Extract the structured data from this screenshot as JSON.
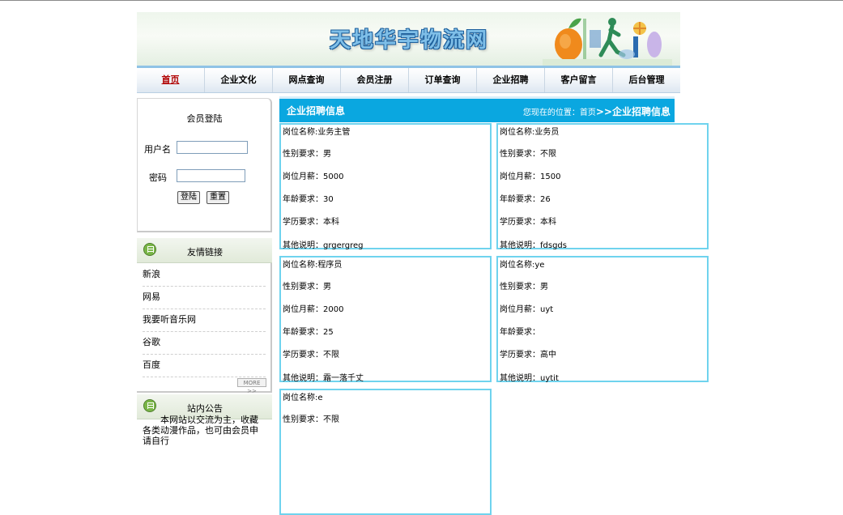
{
  "header": {
    "site_title": "天地华宇物流网"
  },
  "nav": {
    "items": [
      "首页",
      "企业文化",
      "网点查询",
      "会员注册",
      "订单查询",
      "企业招聘",
      "客户留言",
      "后台管理"
    ],
    "active_index": 0
  },
  "login": {
    "title": "会员登陆",
    "username_label": "用户名",
    "password_label": "密码",
    "username_value": "",
    "password_value": "",
    "login_button": "登陆",
    "reset_button": "重置"
  },
  "links": {
    "title": "友情链接",
    "items": [
      "新浪",
      "网易",
      "我要听音乐网",
      "谷歌",
      "百度"
    ],
    "more": "MORE >>"
  },
  "notice": {
    "title": "站内公告",
    "text": "本网站以交流为主，收藏各类动漫作品，也可由会员申请自行"
  },
  "content": {
    "title": "企业招聘信息",
    "breadcrumb_prefix": "您现在的位置：首页",
    "breadcrumb_current": ">>企业招聘信息",
    "field_labels": {
      "name": "岗位名称:",
      "gender": "性别要求：",
      "salary": "岗位月薪：",
      "age": "年龄要求：",
      "education": "学历要求：",
      "other": "其他说明："
    },
    "jobs": [
      {
        "name": "业务主管",
        "gender": "男",
        "salary": "5000",
        "age": "30",
        "education": "本科",
        "other": "grgergreg"
      },
      {
        "name": "业务员",
        "gender": "不限",
        "salary": "1500",
        "age": "26",
        "education": "本科",
        "other": "fdsgds"
      },
      {
        "name": "程序员",
        "gender": "男",
        "salary": "2000",
        "age": "25",
        "education": "不限",
        "other": "霜一落千丈"
      },
      {
        "name": "ye",
        "gender": "男",
        "salary": "uyt",
        "age": "",
        "education": "高中",
        "other": "uytit"
      },
      {
        "name": "e",
        "gender": "不限"
      }
    ]
  },
  "colors": {
    "accent_bar": "#0aa7e0",
    "card_border": "#6fd3ee",
    "nav_active": "#b00000"
  }
}
